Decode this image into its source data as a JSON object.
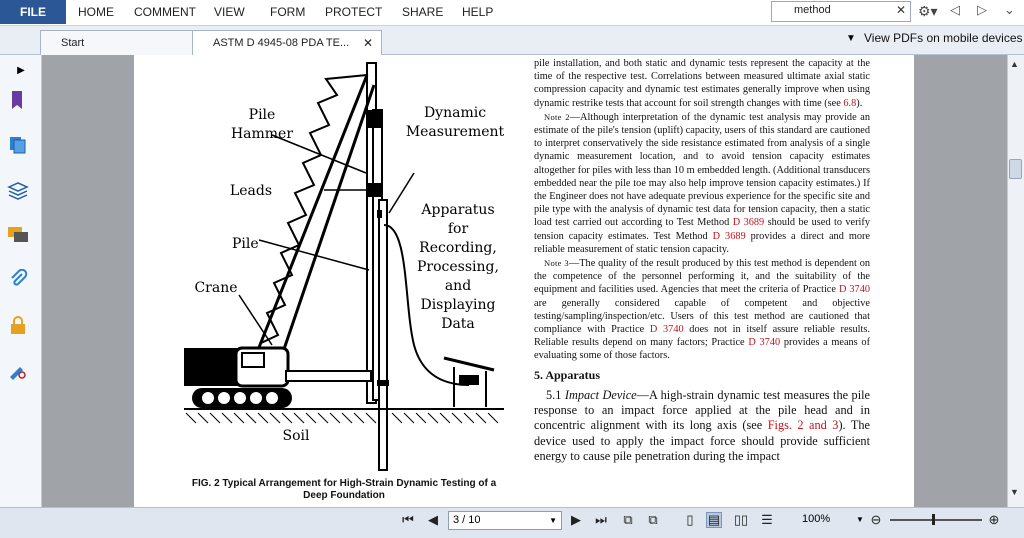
{
  "menubar": {
    "file_label": "FILE",
    "items": [
      "HOME",
      "COMMENT",
      "VIEW",
      "FORM",
      "PROTECT",
      "SHARE",
      "HELP"
    ],
    "search_value": "method"
  },
  "tabs": {
    "start_label": "Start",
    "doc_label": "ASTM D 4945-08 PDA TE...",
    "mobile_label": "View PDFs on mobile devices"
  },
  "figure": {
    "label_pile_hammer_1": "Pile",
    "label_pile_hammer_2": "Hammer",
    "label_dynamic_1": "Dynamic",
    "label_dynamic_2": "Measurement",
    "label_leads": "Leads",
    "label_apparatus": [
      "Apparatus",
      "for",
      "Recording,",
      "Processing,",
      "and",
      "Displaying",
      "Data"
    ],
    "label_pile": "Pile",
    "label_crane": "Crane",
    "label_soil": "Soil",
    "caption_line1": "FIG. 2 Typical Arrangement for High-Strain Dynamic Testing of a",
    "caption_line2": "Deep Foundation"
  },
  "right_text": {
    "p1": "pile installation, and both static and dynamic tests represent the capacity at the time of the respective test. Correlations between measured ultimate axial static compression capacity and dynamic test estimates generally improve when using dynamic restrike tests that account for soil strength changes with time (see ",
    "p1_ref": "6.8",
    "p1_end": ").",
    "note2_label": "Note 2",
    "note2_a": "—Although interpretation of the dynamic test analysis may provide an estimate of the pile's tension (uplift) capacity, users of this standard are cautioned to interpret conservatively the side resistance estimated from analysis of a single dynamic measurement location, and to avoid tension capacity estimates altogether for piles with less than 10 m embedded length. (Additional transducers embedded near the pile toe may also help improve tension capacity estimates.) If the Engineer does not have adequate previous experience for the specific site and pile type with the analysis of dynamic test data for tension capacity, then a static load test carried out according to Test Method ",
    "note2_ref1": "D 3689",
    "note2_b": " should be used to verify tension capacity estimates. Test Method ",
    "note2_ref2": "D 3689",
    "note2_c": " provides a direct and more reliable measurement of static tension capacity.",
    "note3_label": "Note 3",
    "note3_a": "—The quality of the result produced by this test method is dependent on the competence of the personnel performing it, and the suitability of the equipment and facilities used. Agencies that meet the criteria of Practice ",
    "note3_ref1": "D 3740",
    "note3_b": " are generally considered capable of competent and objective testing/sampling/inspection/etc. Users of this test method are cautioned that compliance with Practice ",
    "note3_ref2": "D 3740",
    "note3_c": " does not in itself assure reliable results. Reliable results depend on many factors; Practice ",
    "note3_ref3": "D 3740",
    "note3_d": " provides a means of evaluating some of those factors.",
    "section_heading": "5.  Apparatus",
    "s51_num": "5.1 ",
    "s51_title": "Impact Device",
    "s51_a": "—A high-strain dynamic test measures the pile response to an impact force applied at the pile head and in concentric alignment with its long axis (see ",
    "s51_ref": "Figs. 2 and 3",
    "s51_b": "). The device used to apply the impact force should provide sufficient energy to cause pile penetration during the impact"
  },
  "statusbar": {
    "page_value": "3 / 10",
    "zoom_value": "100%"
  }
}
